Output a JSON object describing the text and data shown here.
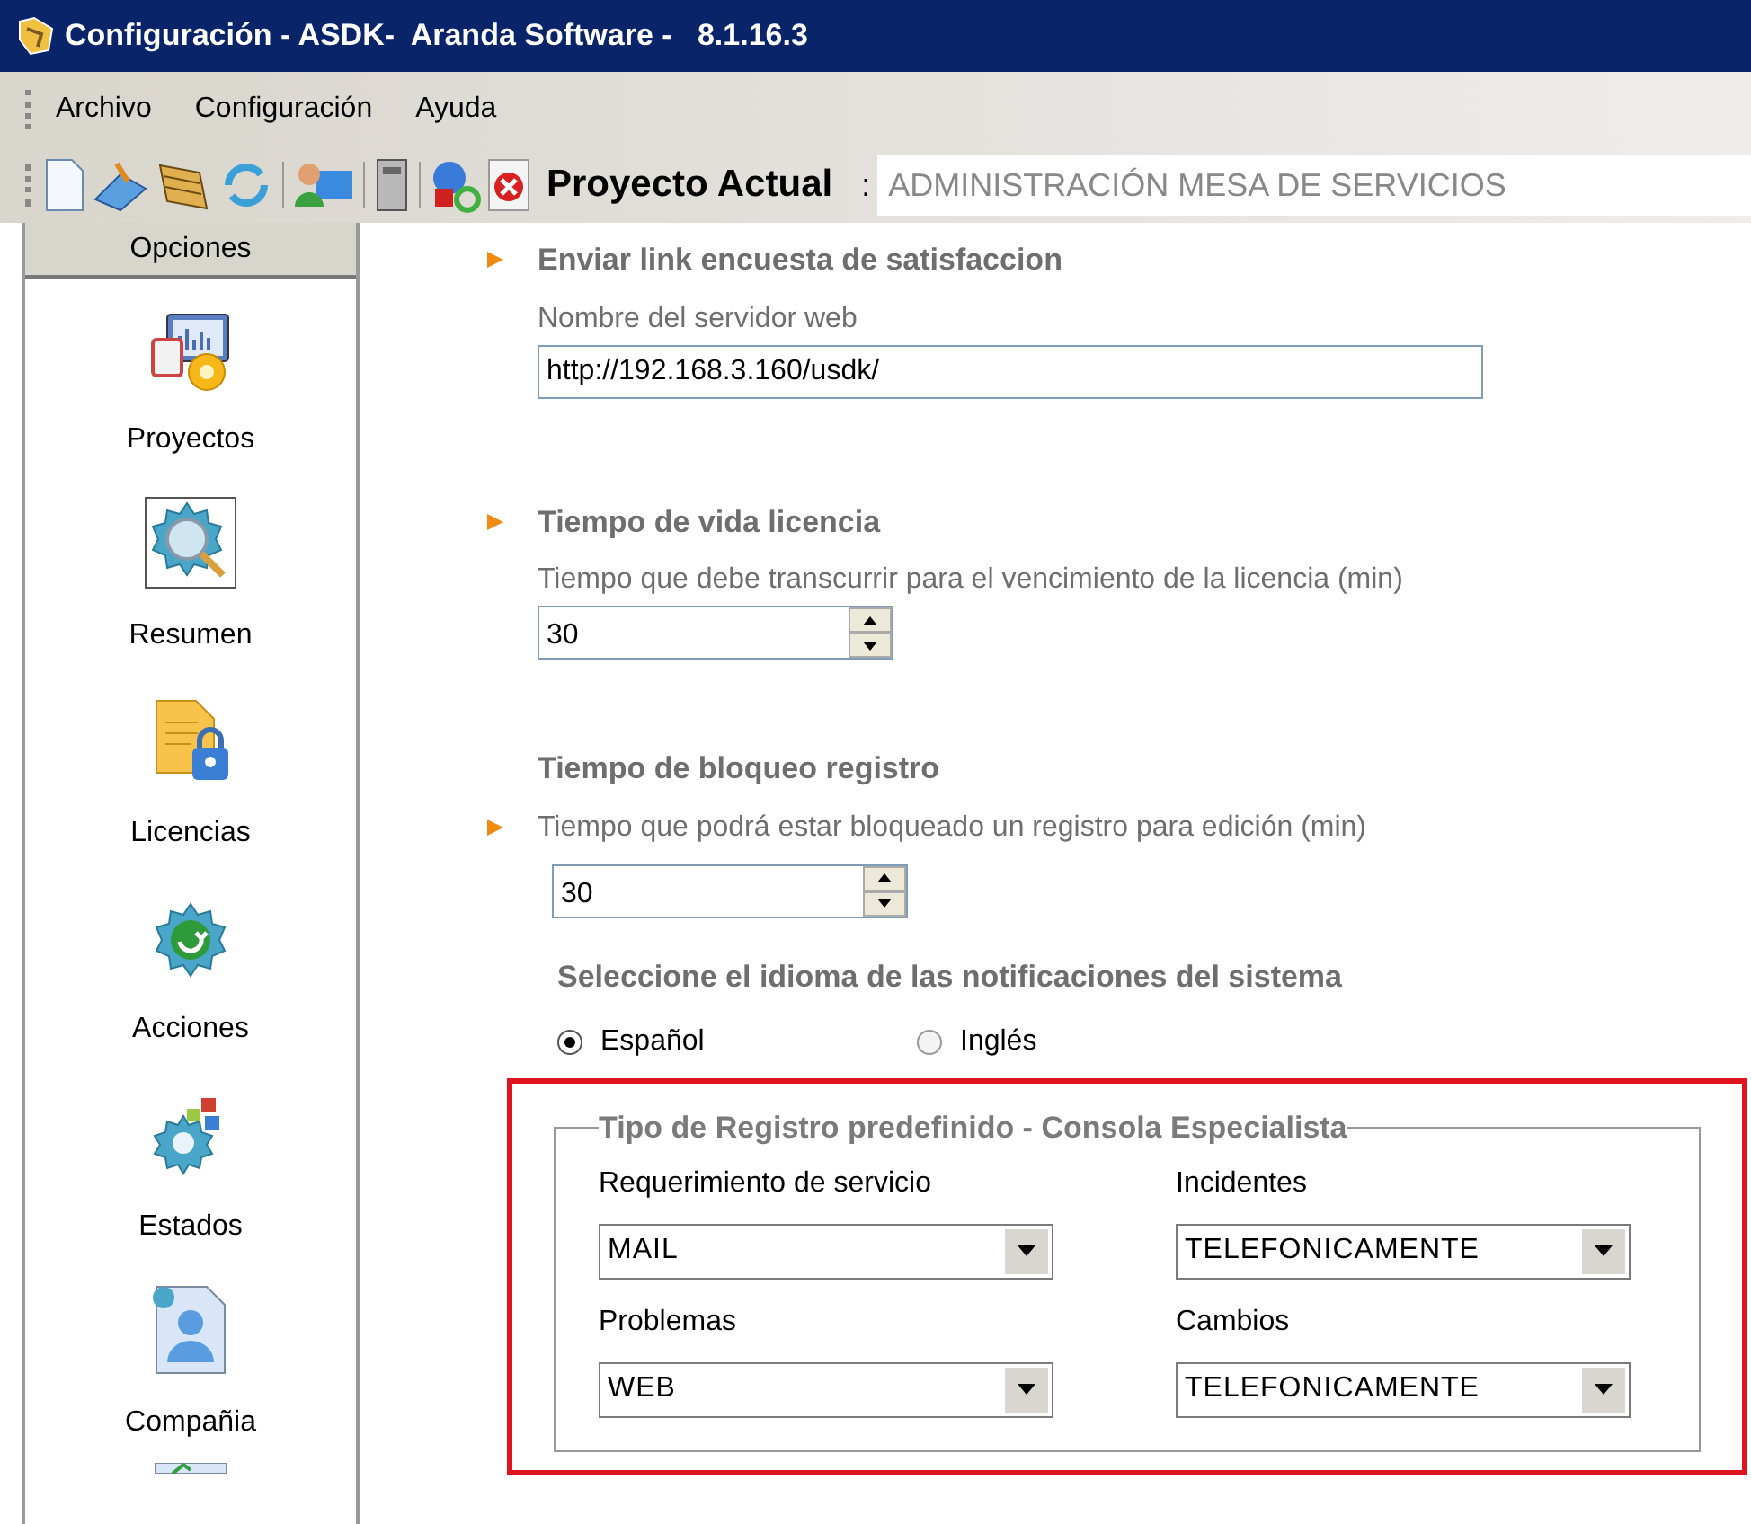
{
  "window": {
    "title": "Configuración - ASDK-  Aranda Software -   8.1.16.3"
  },
  "menu": [
    "Archivo",
    "Configuración",
    "Ayuda"
  ],
  "toolbar": {
    "project_label": "Proyecto Actual",
    "separator": ":",
    "project_value": "ADMINISTRACIÓN MESA DE SERVICIOS"
  },
  "sidebar": {
    "header": "Opciones",
    "items": [
      {
        "label": "Proyectos"
      },
      {
        "label": "Resumen"
      },
      {
        "label": "Licencias"
      },
      {
        "label": "Acciones"
      },
      {
        "label": "Estados"
      },
      {
        "label": "Compañia"
      }
    ]
  },
  "sections": [
    {
      "kind": "text",
      "heading": "Enviar link encuesta de satisfaccion",
      "heading_arrow": true,
      "hint": "Nombre del servidor web",
      "hint_arrow": false,
      "value": "http://192.168.3.160/usdk/"
    },
    {
      "kind": "spinner",
      "heading": "Tiempo de vida licencia",
      "heading_arrow": true,
      "hint": "Tiempo que debe transcurrir para el vencimiento de la licencia (min)",
      "hint_arrow": false,
      "value": "30"
    },
    {
      "kind": "spinner",
      "heading": "Tiempo de bloqueo registro",
      "heading_arrow": false,
      "hint": "Tiempo que podrá estar bloqueado un registro para edición (min)",
      "hint_arrow": true,
      "value": "30"
    },
    {
      "kind": "radio",
      "heading": "Seleccione el idioma de las notificaciones del sistema",
      "options": [
        {
          "label": "Español",
          "selected": true
        },
        {
          "label": "Inglés",
          "selected": false
        }
      ]
    }
  ],
  "group": {
    "title": "Tipo de Registro predefinido - Consola Especialista",
    "highlighted": true,
    "fields": [
      {
        "label": "Requerimiento de servicio",
        "value": "MAIL"
      },
      {
        "label": "Incidentes",
        "value": "TELEFONICAMENTE"
      },
      {
        "label": "Problemas",
        "value": "WEB"
      },
      {
        "label": "Cambios",
        "value": "TELEFONICAMENTE"
      }
    ]
  }
}
